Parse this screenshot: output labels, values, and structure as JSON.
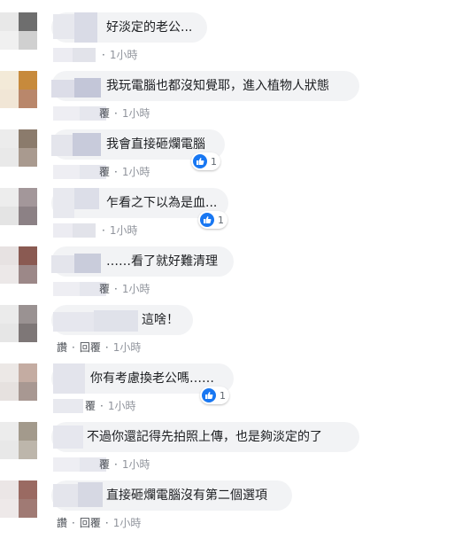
{
  "actions": {
    "like": "讚",
    "reply": "回覆"
  },
  "comments": [
    {
      "text": "好淡定的老公...",
      "time": "1小時",
      "likes": null
    },
    {
      "text": "我玩電腦也都沒知覺耶，進入植物人狀態",
      "time": "1小時",
      "likes": null
    },
    {
      "text": "我會直接砸爛電腦",
      "time": "1小時",
      "likes": "1"
    },
    {
      "text": "乍看之下以為是血...",
      "time": "1小時",
      "likes": "1"
    },
    {
      "text": "……看了就好難清理",
      "time": "1小時",
      "likes": null
    },
    {
      "text": "這啥！",
      "time": "1小時",
      "likes": null
    },
    {
      "text": "你有考慮換老公嗎……",
      "time": "1小時",
      "likes": "1"
    },
    {
      "text": "不過你還記得先拍照上傳，也是夠淡定的了",
      "time": "1小時",
      "likes": null
    },
    {
      "text": "直接砸爛電腦沒有第二個選項",
      "time": "1小時",
      "likes": null
    }
  ],
  "colors": {
    "bubble": "#f2f3f5",
    "like": "#1877f2",
    "meta": "#606770"
  },
  "icons": {
    "reaction": "like-thumb-icon"
  }
}
